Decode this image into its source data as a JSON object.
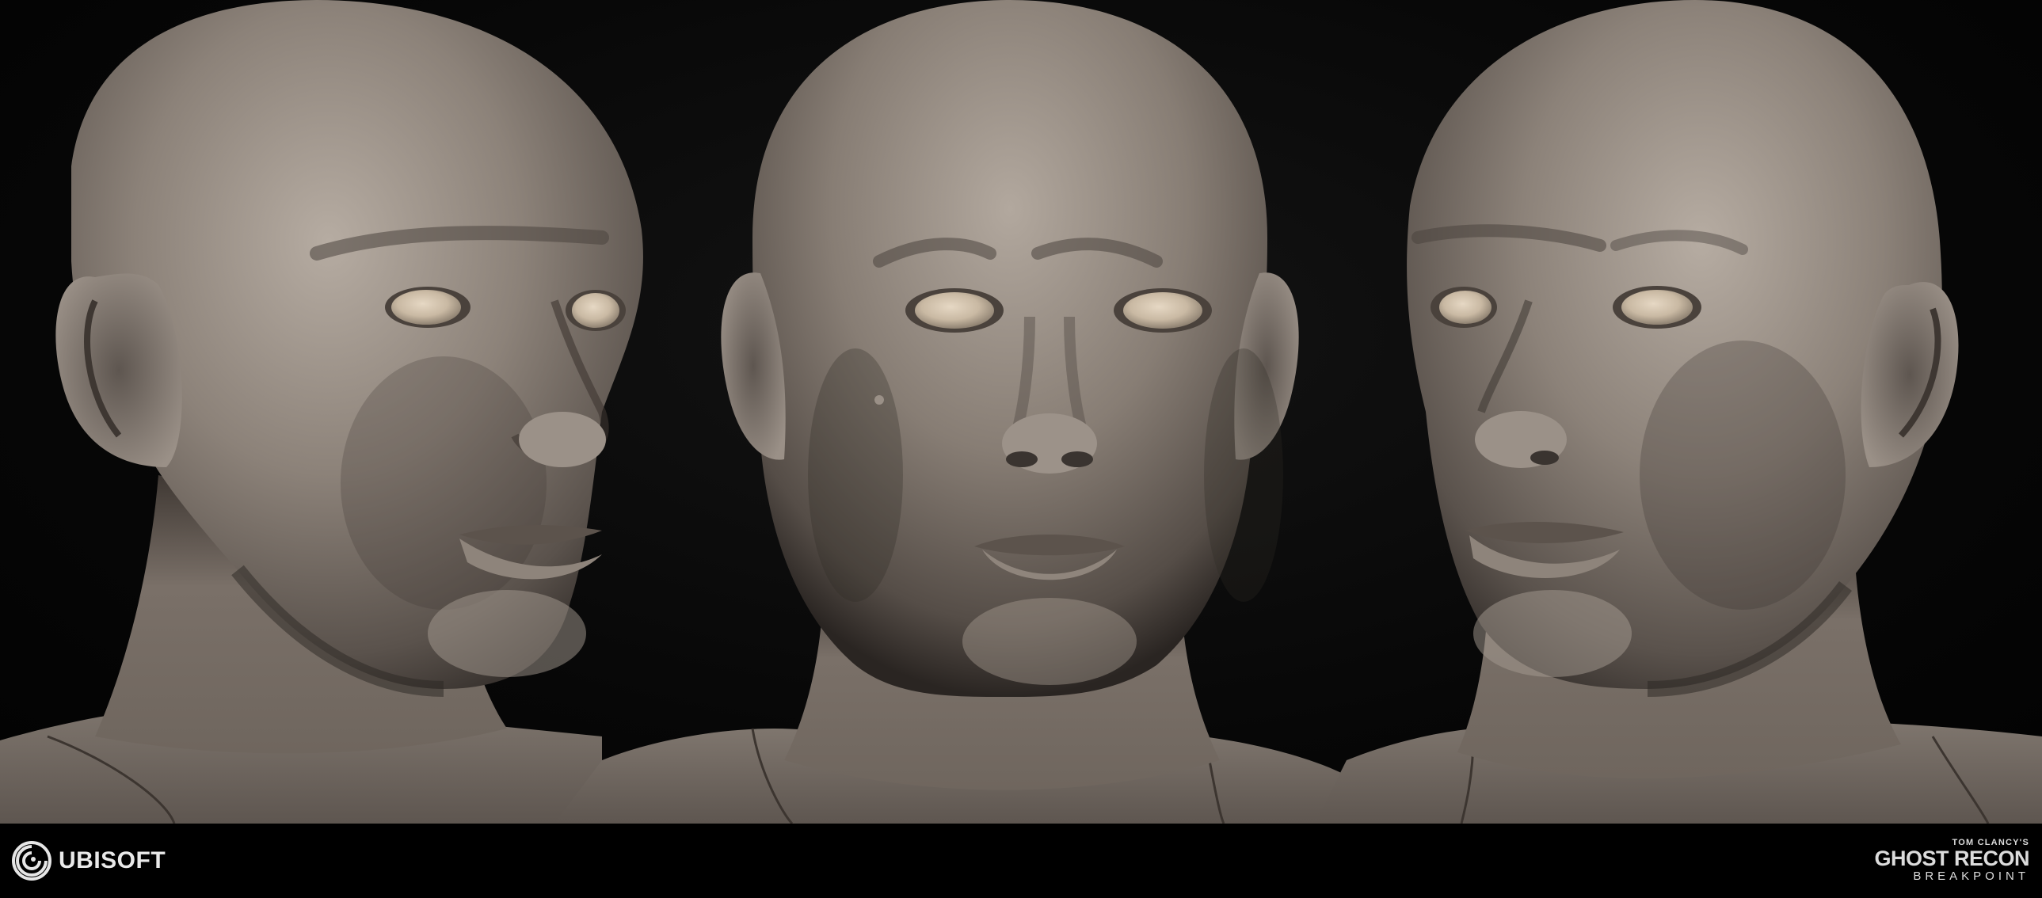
{
  "footer": {
    "publisher_logo": "UBISOFT",
    "game_logo_small": "TOM CLANCY'S",
    "game_logo_title": "GHOST RECON",
    "game_logo_subtitle": "BREAKPOINT"
  },
  "colors": {
    "background": "#000000",
    "skin_base": "#8a8078",
    "skin_shadow": "#3a3430",
    "skin_highlight": "#b8aea4",
    "eye": "#d4c4ae",
    "footer_text": "#e6e6e6"
  },
  "views": [
    "left-three-quarter-head",
    "front-head",
    "right-three-quarter-head"
  ]
}
